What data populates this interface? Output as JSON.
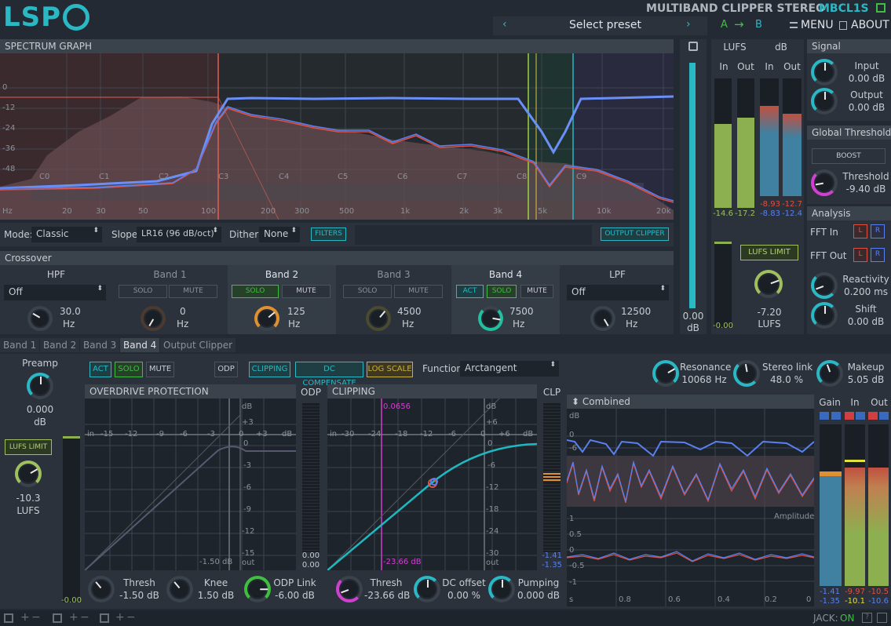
{
  "app": {
    "logo": "LSP",
    "title": "MULTIBAND CLIPPER STEREO",
    "code": "MBCL1S",
    "preset_label": "Select preset",
    "ab_a": "A",
    "ab_arrow": "→",
    "ab_b": "B",
    "menu": "MENU",
    "about": "ABOUT"
  },
  "spectrum": {
    "title": "SPECTRUM GRAPH",
    "db_ticks": [
      "0",
      "-12",
      "-24",
      "-36",
      "-48"
    ],
    "freq_ticks": [
      "Hz",
      "20",
      "30",
      "50",
      "100",
      "200",
      "300",
      "500",
      "1k",
      "2k",
      "3k",
      "5k",
      "10k",
      "20k"
    ],
    "notes": [
      "C0",
      "C1",
      "C2",
      "C3",
      "C4",
      "C5",
      "C6",
      "C7",
      "C8",
      "C9"
    ]
  },
  "controls": {
    "mode_label": "Mode:",
    "mode_value": "Classic",
    "slope_label": "Slope",
    "slope_value": "LR16 (96 dB/oct)",
    "dither_label": "Dither:",
    "dither_value": "None",
    "filters_btn": "FILTERS",
    "output_clipper_btn": "OUTPUT CLIPPER"
  },
  "crossover": {
    "title": "Crossover",
    "hpf": {
      "name": "HPF",
      "select": "Off",
      "value": "30.0",
      "unit": "Hz"
    },
    "lpf": {
      "name": "LPF",
      "select": "Off",
      "value": "12500",
      "unit": "Hz"
    },
    "bands": [
      {
        "name": "Band 1",
        "act": "",
        "solo": "SOLO",
        "mute": "MUTE",
        "value": "0",
        "unit": "Hz"
      },
      {
        "name": "Band 2",
        "act": "",
        "solo": "SOLO",
        "mute": "MUTE",
        "value": "125",
        "unit": "Hz"
      },
      {
        "name": "Band 3",
        "act": "",
        "solo": "SOLO",
        "mute": "MUTE",
        "value": "4500",
        "unit": "Hz"
      },
      {
        "name": "Band 4",
        "act": "ACT",
        "solo": "SOLO",
        "mute": "MUTE",
        "value": "7500",
        "unit": "Hz"
      }
    ]
  },
  "tabs": [
    "Band 1",
    "Band 2",
    "Band 3",
    "Band 4",
    "Output Clipper"
  ],
  "zoom": {
    "value": "0.00",
    "unit": "dB"
  },
  "lufs_meter": {
    "title": "LUFS",
    "in": "In",
    "out": "Out",
    "in_val": "-14.6",
    "out_val": "-17.2",
    "low_val": "-0.00",
    "lufs_limit": "LUFS LIMIT",
    "knob_val": "-7.20",
    "knob_unit": "LUFS"
  },
  "db_meter": {
    "title": "dB",
    "in": "In",
    "out": "Out",
    "in_a": "-8.93",
    "in_b": "-8.83",
    "out_a": "-12.7",
    "out_b": "-12.4"
  },
  "signal": {
    "title": "Signal",
    "input_label": "Input",
    "input_val": "0.00 dB",
    "output_label": "Output",
    "output_val": "0.00 dB"
  },
  "global": {
    "title": "Global Threshold",
    "boost": "BOOST",
    "thr_label": "Threshold",
    "thr_val": "-9.40 dB"
  },
  "analysis": {
    "title": "Analysis",
    "fft_in": "FFT In",
    "fft_out": "FFT Out",
    "l": "L",
    "r": "R",
    "react_label": "Reactivity",
    "react_val": "0.200 ms",
    "shift_label": "Shift",
    "shift_val": "0.00 dB"
  },
  "band": {
    "preamp_label": "Preamp",
    "preamp_val": "0.000",
    "preamp_unit": "dB",
    "lufs_limit": "LUFS LIMIT",
    "lufs_val": "-10.3",
    "lufs_unit": "LUFS",
    "meter_val": "-0.00",
    "act": "ACT",
    "solo": "SOLO",
    "mute": "MUTE",
    "odp": "ODP",
    "clipping": "CLIPPING",
    "dc": "DC COMPENSATE",
    "log": "LOG SCALE",
    "function_label": "Function",
    "function_val": "Arctangent",
    "resonance_label": "Resonance",
    "resonance_val": "10068 Hz",
    "stereo_label": "Stereo link",
    "stereo_val": "48.0 %",
    "makeup_label": "Makeup",
    "makeup_val": "5.05 dB"
  },
  "odp": {
    "title": "OVERDRIVE PROTECTION",
    "meter_title": "ODP",
    "in": "in",
    "db": "dB",
    "out": "out",
    "xticks": [
      "-15",
      "-12",
      "-9",
      "-6",
      "-3",
      "0",
      "+3"
    ],
    "yticks": [
      "dB",
      "+3",
      "0",
      "-3",
      "-6",
      "-9",
      "-12",
      "-15"
    ],
    "marker": "-1.50 dB",
    "meter_a": "0.00",
    "meter_b": "0.00",
    "thresh_label": "Thresh",
    "thresh_val": "-1.50 dB",
    "knee_label": "Knee",
    "knee_val": "1.50 dB",
    "link_label": "ODP Link",
    "link_val": "-6.00 dB"
  },
  "clip": {
    "title": "CLIPPING",
    "meter_title": "CLP",
    "in": "in",
    "db": "dB",
    "out": "out",
    "xticks": [
      "-30",
      "-24",
      "-18",
      "-12",
      "-6",
      "0",
      "+6"
    ],
    "yticks": [
      "dB",
      "+6",
      "0",
      "-6",
      "-12",
      "-18",
      "-24",
      "-30"
    ],
    "marker_top": "0.0656",
    "marker_bot": "-23.66 dB",
    "meter_a": "-1.41",
    "meter_b": "-1.35",
    "thresh_label": "Thresh",
    "thresh_val": "-23.66 dB",
    "dc_label": "DC offset",
    "dc_val": "0.00 %",
    "pump_label": "Pumping",
    "pump_val": "0.000 dB"
  },
  "wave": {
    "title": "Combined",
    "db": "dB",
    "zero": "0",
    "m6": "-6",
    "amp": "Amplitude",
    "a1": "1",
    "a05": "0.5",
    "a0": "0",
    "am05": "-0.5",
    "am1": "-1",
    "s": "s",
    "t08": "0.8",
    "t06": "0.6",
    "t04": "0.4",
    "t02": "0.2",
    "t0": "0"
  },
  "out_meters": {
    "gain": "Gain",
    "in": "In",
    "out": "Out",
    "gain_a": "-1.41",
    "gain_b": "-1.35",
    "in_a": "-9.97",
    "in_b": "-10.1",
    "out_a": "-10.5",
    "out_b": "-10.6"
  },
  "status": {
    "jack": "JACK:",
    "jack_state": "ON"
  },
  "colors": {
    "accent": "#2ab8c4",
    "green": "#3fbf3f",
    "curve": "#5a80f0",
    "red": "#e05040",
    "magenta": "#d040d0"
  }
}
